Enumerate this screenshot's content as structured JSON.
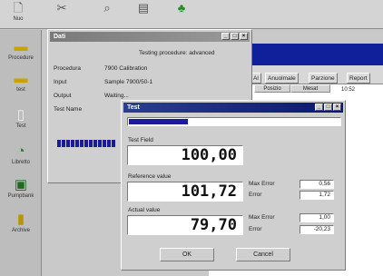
{
  "toolbar": {
    "items": [
      {
        "label": "Nuo",
        "icon": "new-document-icon"
      },
      {
        "label": "",
        "icon": "cut-icon"
      },
      {
        "label": "",
        "icon": "search-icon"
      },
      {
        "label": "",
        "icon": "view-icon"
      },
      {
        "label": "",
        "icon": "connect-icon"
      }
    ]
  },
  "sidebar": {
    "items": [
      {
        "label": "Procedure",
        "icon": "folder-icon"
      },
      {
        "label": "test",
        "icon": "folder-icon"
      },
      {
        "label": "Test",
        "icon": "document-icon"
      },
      {
        "label": "Libretto",
        "icon": "chart-icon"
      },
      {
        "label": "Pumpbank",
        "icon": "monitor-icon"
      },
      {
        "label": "Archive",
        "icon": "archive-icon"
      }
    ]
  },
  "background_window": {
    "tabs": [
      "Al",
      "Anuolmale",
      "Parzione",
      "Report"
    ],
    "columns": [
      "Posizio",
      "Mesat"
    ],
    "cell": "10:52"
  },
  "info_dialog": {
    "title": "Dati",
    "message": "Testing procedure: advanced",
    "rows": [
      {
        "key": "Procedura",
        "value": "7900 Calibration"
      },
      {
        "key": "Input",
        "value": "Sample 7900/50-1"
      },
      {
        "key": "Output",
        "value": "Waiting..."
      },
      {
        "key": "Test Name",
        "value": ""
      }
    ],
    "progress_segments": 13
  },
  "measure_dialog": {
    "title": "Test",
    "progress": 0.28,
    "groups": [
      {
        "label": "Test Field",
        "value": "100,00"
      },
      {
        "label": "Reference value",
        "value": "101,72",
        "side": [
          {
            "label": "Max Error",
            "value": "0,56"
          },
          {
            "label": "Error",
            "value": "1,72"
          }
        ]
      },
      {
        "label": "Actual value",
        "value": "79,70",
        "side": [
          {
            "label": "Max Error",
            "value": "1,00"
          },
          {
            "label": "Error",
            "value": "-20,23"
          }
        ]
      }
    ],
    "ok_label": "OK",
    "cancel_label": "Cancel"
  }
}
